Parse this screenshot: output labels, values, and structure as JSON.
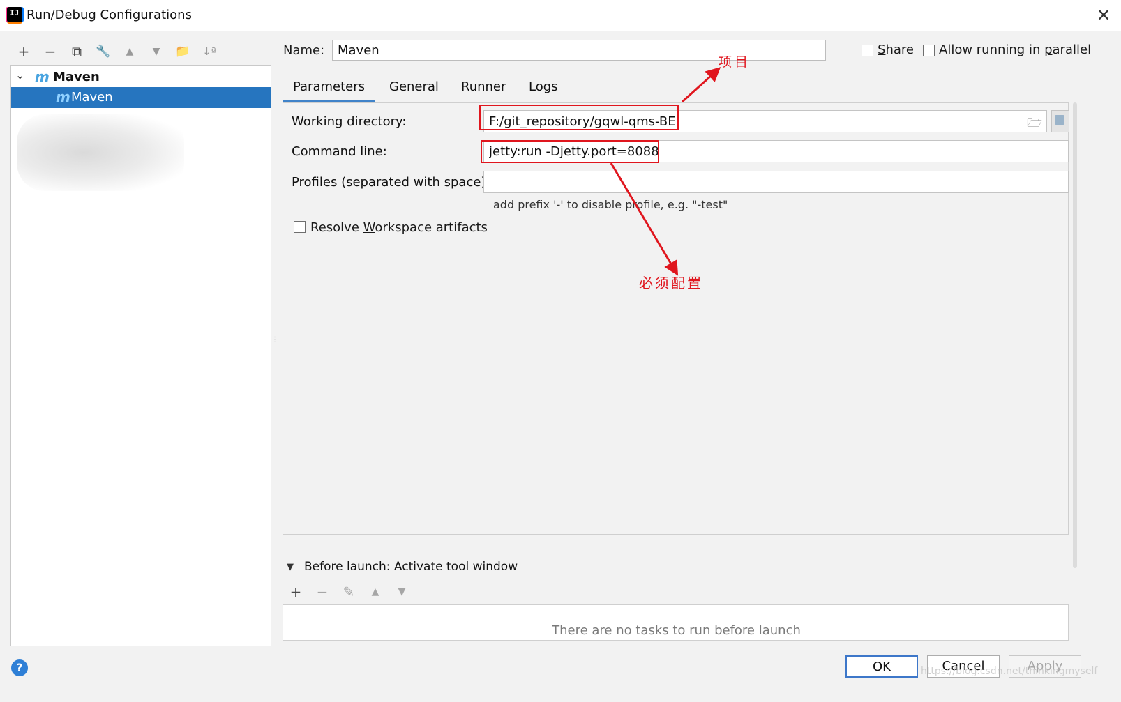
{
  "window": {
    "title": "Run/Debug Configurations",
    "close_glyph": "✕"
  },
  "icons": {
    "app": "intellij-app-icon",
    "add": "plus-icon",
    "remove": "minus-icon",
    "copy": "copy-icon",
    "edit_defaults": "wrench-icon",
    "move_up": "arrow-up-icon",
    "move_down": "arrow-down-icon",
    "folder": "new-folder-icon",
    "sort": "sort-alpha-icon",
    "maven": "maven-icon",
    "chevron": "chevron-down-icon",
    "help": "help-icon"
  },
  "toolbar": {
    "add": "+",
    "remove": "−",
    "copy": "⧉",
    "wrench": "🔧",
    "up": "▲",
    "down": "▼",
    "folder": "📁",
    "sort": "↓ª"
  },
  "tree": {
    "root": {
      "chevron": "⌄",
      "icon_letter": "m",
      "label": "Maven"
    },
    "child": {
      "icon_letter": "m",
      "label": "Maven"
    }
  },
  "name": {
    "label": "Name:",
    "value": "Maven"
  },
  "share": {
    "label_first": "S",
    "label_rest": "hare",
    "checked": false
  },
  "parallel": {
    "label_pre": "Allow running in ",
    "label_u": "p",
    "label_post": "arallel",
    "checked": false
  },
  "tabs": [
    {
      "label": "Parameters",
      "active": true
    },
    {
      "label": "General",
      "active": false
    },
    {
      "label": "Runner",
      "active": false
    },
    {
      "label": "Logs",
      "active": false
    }
  ],
  "parameters": {
    "working_directory": {
      "label": "Working directory:",
      "value": "F:/git_repository/gqwl-qms-BE"
    },
    "command_line": {
      "label": "Command line:",
      "value": "jetty:run -Djetty.port=8088"
    },
    "profiles": {
      "label": "Profiles (separated with space):",
      "value": "",
      "hint": "add prefix '-' to disable profile, e.g. \"-test\""
    },
    "resolve_workspace": {
      "label_pre": "Resolve ",
      "label_u": "W",
      "label_post": "orkspace artifacts",
      "checked": false
    }
  },
  "annotations": {
    "project": "项目",
    "required": "必须配置",
    "color": "#e0161e"
  },
  "before_launch": {
    "chevron": "▼",
    "title": "Before launch: Activate tool window",
    "empty_text": "There are no tasks to run before launch",
    "tools": {
      "add": "+",
      "remove": "−",
      "edit": "✎",
      "up": "▲",
      "down": "▼"
    }
  },
  "buttons": {
    "ok": "OK",
    "cancel_u": "C",
    "cancel_rest": "ancel",
    "apply_u": "A",
    "apply_rest": "pply",
    "help": "?"
  },
  "watermark": "https://blog.csdn.net/thinkingmyself",
  "colors": {
    "selection": "#2675bf",
    "accent": "#4083c9",
    "annotation": "#e0161e"
  }
}
